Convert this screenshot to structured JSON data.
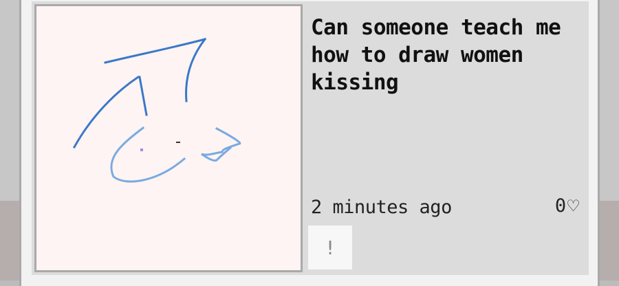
{
  "post": {
    "title": "Can someone teach me how to draw women kissing",
    "timestamp": "2 minutes ago",
    "like_count": "0",
    "like_icon": "heart-outline-icon",
    "report_label": "!"
  },
  "colors": {
    "card_bg": "#dcdcdc",
    "canvas_bg": "#fdf4f3",
    "stroke_dark_blue": "#3a78c8",
    "stroke_light_blue": "#7aaae0",
    "dot_purple": "#a58ae6"
  }
}
